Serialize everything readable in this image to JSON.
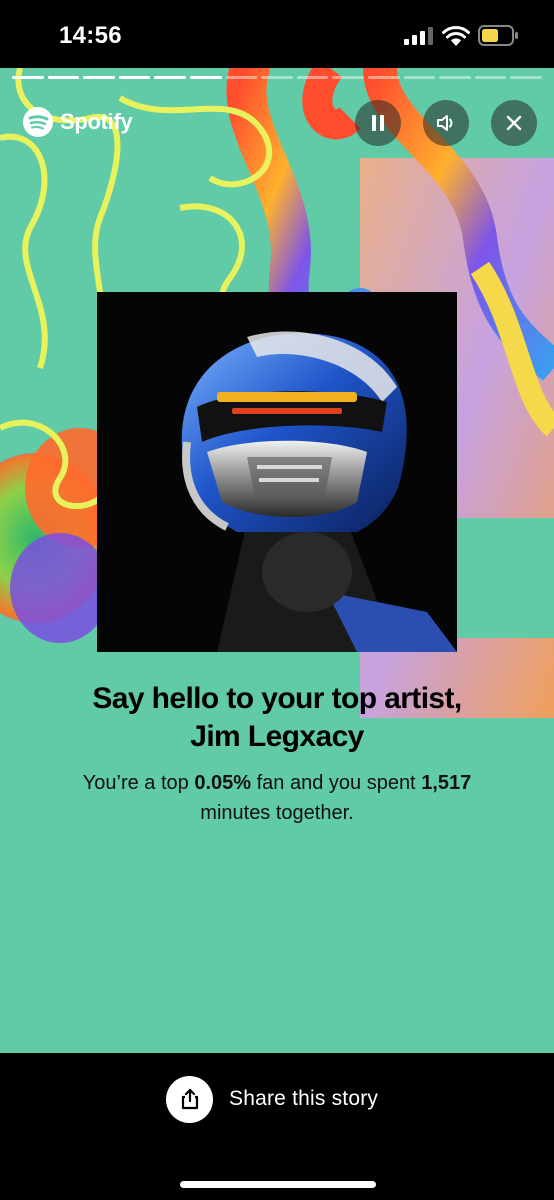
{
  "status_bar": {
    "time": "14:56"
  },
  "story": {
    "progress": {
      "total_segments": 15,
      "completed_segments": 6
    },
    "brand": "Spotify",
    "controls": {
      "pause": "pause-icon",
      "sound": "speaker-icon",
      "close": "close-icon"
    },
    "headline_line1": "Say hello to your top artist,",
    "headline_line2": "Jim Legxacy",
    "sub_part1": "You’re a top ",
    "sub_percent": "0.05%",
    "sub_part2": " fan and you spent ",
    "sub_minutes": "1,517",
    "sub_part3": "minutes together."
  },
  "share": {
    "label": "Share this story"
  },
  "colors": {
    "background": "#60cba6",
    "yellow_line": "#e8f25c",
    "bar": "#000000"
  }
}
